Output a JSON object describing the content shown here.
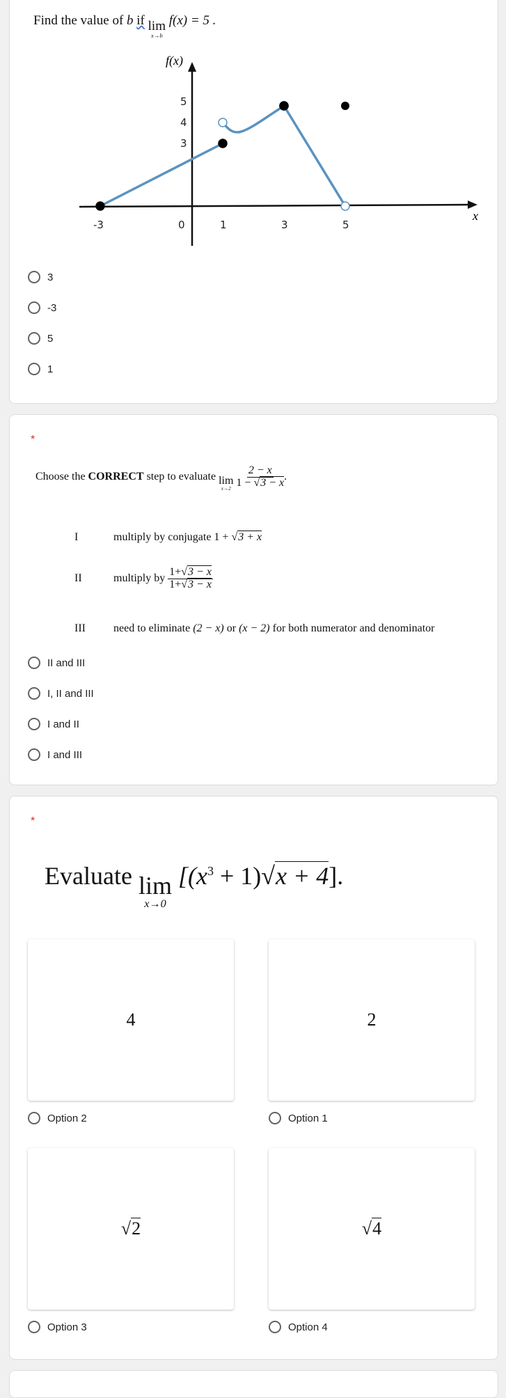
{
  "q1": {
    "prompt_prefix": "Find the value of",
    "var_b": "b",
    "if_word": "if",
    "lim": "lim",
    "lim_sub": "x→b",
    "expr": "f(x) = 5 .",
    "options": [
      "3",
      "-3",
      "5",
      "1"
    ]
  },
  "chart_data": {
    "type": "line",
    "title": "",
    "xlabel": "x",
    "ylabel": "f(x)",
    "x_ticks": [
      "-3",
      "0",
      "1",
      "3",
      "5"
    ],
    "y_ticks": [
      "3",
      "4",
      "5"
    ],
    "line_color": "#5b93c0",
    "segments": [
      {
        "name": "linear",
        "points": [
          [
            -3,
            0
          ],
          [
            1,
            3
          ]
        ],
        "start": "closed",
        "end": "closed"
      },
      {
        "name": "curve",
        "points": [
          [
            1,
            4
          ],
          [
            1.6,
            3.6
          ],
          [
            2.3,
            3.8
          ],
          [
            3,
            4.8
          ]
        ],
        "start": "open",
        "end": "closed"
      },
      {
        "name": "decline",
        "points": [
          [
            3,
            4.8
          ],
          [
            5,
            0
          ]
        ],
        "start": "closed",
        "end": "open"
      }
    ],
    "isolated_points": [
      {
        "x": 5,
        "y": 4.8,
        "type": "closed"
      }
    ]
  },
  "q2": {
    "required": "*",
    "prompt_prefix": "Choose the",
    "prompt_bold": "CORRECT",
    "prompt_suffix": "step to evaluate",
    "lim": "lim",
    "lim_sub": "x→2",
    "num": "2 − x",
    "den_prefix": "1 − ",
    "den_rad": "3 − x",
    "period": ".",
    "steps": [
      {
        "num": "I",
        "text": "multiply by conjugate",
        "math_prefix": "1 + ",
        "math_rad": "3 + x"
      },
      {
        "num": "II",
        "text": "multiply by",
        "frac_num_prefix": "1+",
        "frac_num_rad": "3 − x",
        "frac_den_prefix": "1+",
        "frac_den_rad": "3 − x"
      },
      {
        "num": "III",
        "text_a": "need to eliminate",
        "m1": "(2 − x)",
        "text_b": "or",
        "m2": "(x − 2)",
        "text_c": "for both numerator and denominator"
      }
    ],
    "options": [
      "II and III",
      "I, II and III",
      "I and II",
      "I and III"
    ]
  },
  "q3": {
    "required": "*",
    "prompt": "Evaluate",
    "lim": "lim",
    "lim_sub": "x→0",
    "expr_a": "[(x",
    "exp": "3",
    "expr_b": " + 1)",
    "rad": "x + 4",
    "expr_c": "].",
    "choices": [
      {
        "value": "4",
        "label": "Option 2"
      },
      {
        "value": "2",
        "label": "Option 1"
      },
      {
        "value": "2",
        "label": "Option 3",
        "sqrt": true
      },
      {
        "value": "4",
        "label": "Option 4",
        "sqrt": true
      }
    ]
  }
}
